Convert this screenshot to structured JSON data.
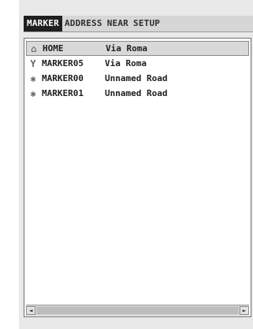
{
  "tabs": [
    {
      "label": "MARKER",
      "active": true
    },
    {
      "label": "ADDRESS",
      "active": false
    },
    {
      "label": "NEAR",
      "active": false
    },
    {
      "label": "SETUP",
      "active": false
    }
  ],
  "rows": [
    {
      "icon": "home-icon",
      "glyph": "⌂",
      "name": "HOME",
      "address": "Via Roma",
      "selected": true
    },
    {
      "icon": "restaurant-glass-icon",
      "glyph": "Y",
      "name": "MARKER05",
      "address": "Via Roma",
      "selected": false
    },
    {
      "icon": "star-marker-icon",
      "glyph": "✱",
      "name": "MARKER00",
      "address": "Unnamed Road",
      "selected": false
    },
    {
      "icon": "star-marker-icon",
      "glyph": "✱",
      "name": "MARKER01",
      "address": "Unnamed Road",
      "selected": false
    }
  ],
  "scrollbar": {
    "left_glyph": "◄",
    "right_glyph": "►"
  },
  "colors": {
    "active_tab_bg": "#1f1f1f",
    "active_tab_text": "#ffffff",
    "selected_row_bg": "#d9d9d9"
  }
}
